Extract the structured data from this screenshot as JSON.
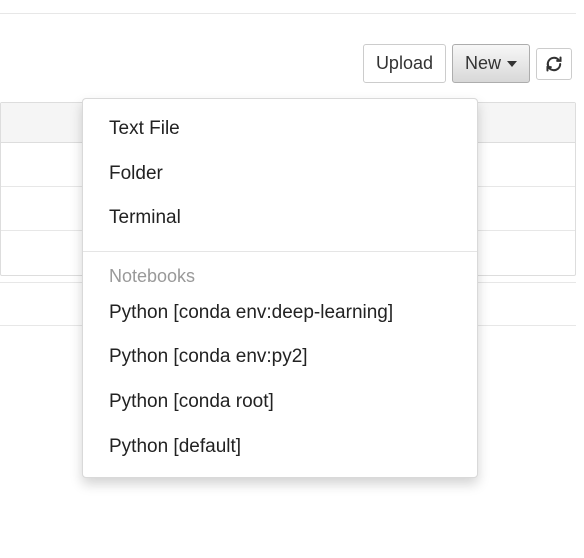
{
  "toolbar": {
    "upload_label": "Upload",
    "new_label": "New",
    "refresh_title": "Refresh"
  },
  "dropdown": {
    "items_top": [
      "Text File",
      "Folder",
      "Terminal"
    ],
    "section_header": "Notebooks",
    "notebooks": [
      "Python [conda env:deep-learning]",
      "Python [conda env:py2]",
      "Python [conda root]",
      "Python [default]"
    ]
  }
}
